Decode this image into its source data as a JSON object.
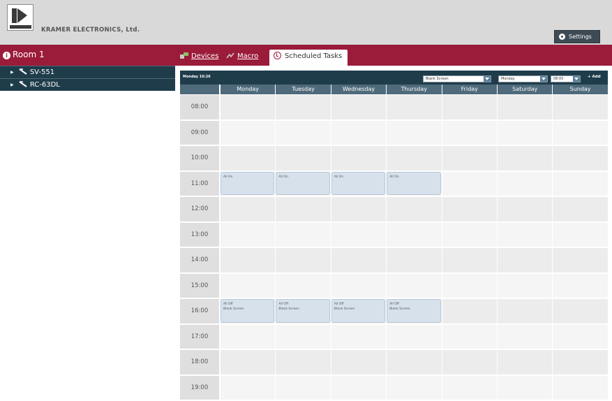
{
  "header": {
    "brand": "KRAMER ELECTRONICS, Ltd.",
    "settings_label": "Settings"
  },
  "room": {
    "title": "Room 1"
  },
  "tabs": [
    {
      "label": "Devices",
      "icon": "devices-icon"
    },
    {
      "label": "Macro",
      "icon": "macro-icon"
    },
    {
      "label": "Scheduled Tasks",
      "icon": "clock-icon",
      "active": true
    }
  ],
  "devices": [
    {
      "label": "SV-551"
    },
    {
      "label": "RC-63DL"
    }
  ],
  "scheduler": {
    "now": "Monday 16:26",
    "macro_select": "Blank Screen",
    "day_select": "Monday",
    "time_select": "08:00",
    "add_label": "+ Add",
    "days": [
      "Monday",
      "Tuesday",
      "Wednesday",
      "Thursday",
      "Friday",
      "Saturday",
      "Sunday"
    ],
    "times": [
      "08:00",
      "09:00",
      "10:00",
      "11:00",
      "12:00",
      "13:00",
      "14:00",
      "15:00",
      "16:00",
      "17:00",
      "18:00",
      "19:00"
    ],
    "events": [
      {
        "day": 0,
        "time": 3,
        "lines": [
          "All On"
        ]
      },
      {
        "day": 1,
        "time": 3,
        "lines": [
          "All On"
        ]
      },
      {
        "day": 2,
        "time": 3,
        "lines": [
          "All On"
        ]
      },
      {
        "day": 3,
        "time": 3,
        "lines": [
          "All On"
        ]
      },
      {
        "day": 0,
        "time": 8,
        "lines": [
          "All Off",
          "Blank Screen"
        ]
      },
      {
        "day": 1,
        "time": 8,
        "lines": [
          "All Off",
          "Blank Screen"
        ]
      },
      {
        "day": 2,
        "time": 8,
        "lines": [
          "All Off",
          "Blank Screen"
        ]
      },
      {
        "day": 3,
        "time": 8,
        "lines": [
          "All Off",
          "Blank Screen"
        ]
      }
    ]
  },
  "colors": {
    "accent_red": "#9b1b3a",
    "navy": "#1f3c4b",
    "header_gray": "#d9d9d9",
    "event_blue": "#d6e1ec"
  }
}
